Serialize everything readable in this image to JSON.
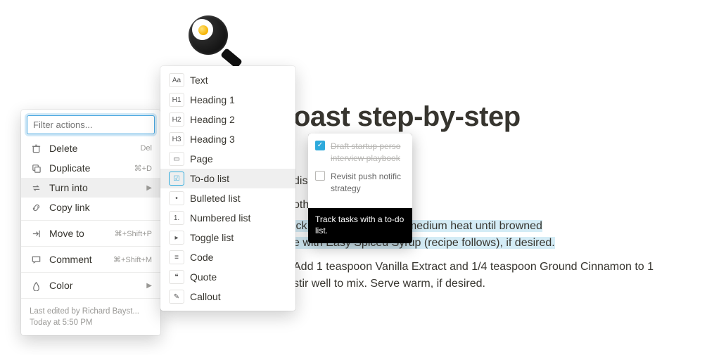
{
  "page": {
    "title_visible": "oast step-by-step",
    "lines": {
      "l1_suffix": "dish. Stir in milk.",
      "l2_suffix": "oth sides evenly.",
      "l3a_prefix": "ick griddle or skillet on medium heat until browned",
      "l3b": "e with Easy Spiced Syrup (recipe follows), if desired.",
      "l4a": "Add 1 teaspoon Vanilla Extract and 1/4 teaspoon Ground Cinnamon to 1",
      "l4b": "stir well to mix. Serve warm, if desired."
    }
  },
  "actions": {
    "filter_placeholder": "Filter actions...",
    "items": [
      {
        "label": "Delete",
        "kbd": "Del"
      },
      {
        "label": "Duplicate",
        "kbd": "⌘+D"
      },
      {
        "label": "Turn into",
        "kbd": "",
        "chev": true,
        "active": true
      },
      {
        "label": "Copy link",
        "kbd": ""
      }
    ],
    "items2": [
      {
        "label": "Move to",
        "kbd": "⌘+Shift+P"
      }
    ],
    "items3": [
      {
        "label": "Comment",
        "kbd": "⌘+Shift+M"
      }
    ],
    "items4": [
      {
        "label": "Color",
        "kbd": "",
        "chev": true
      }
    ],
    "foot1": "Last edited by Richard Bayst...",
    "foot2": "Today at 5:50 PM"
  },
  "turn_into": {
    "items": [
      {
        "label": "Text",
        "ic": "Aa"
      },
      {
        "label": "Heading 1",
        "ic": "H1"
      },
      {
        "label": "Heading 2",
        "ic": "H2"
      },
      {
        "label": "Heading 3",
        "ic": "H3"
      },
      {
        "label": "Page",
        "ic": "▭"
      },
      {
        "label": "To-do list",
        "ic": "☑",
        "active": true
      },
      {
        "label": "Bulleted list",
        "ic": "•"
      },
      {
        "label": "Numbered list",
        "ic": "1."
      },
      {
        "label": "Toggle list",
        "ic": "▸"
      },
      {
        "label": "Code",
        "ic": "≡"
      },
      {
        "label": "Quote",
        "ic": "❝"
      },
      {
        "label": "Callout",
        "ic": "✎"
      }
    ]
  },
  "tooltip": {
    "checked_text": "Draft startup perso interview playbook",
    "unchecked_text": "Revisit push notific strategy",
    "caption": "Track tasks with a to-do list."
  }
}
